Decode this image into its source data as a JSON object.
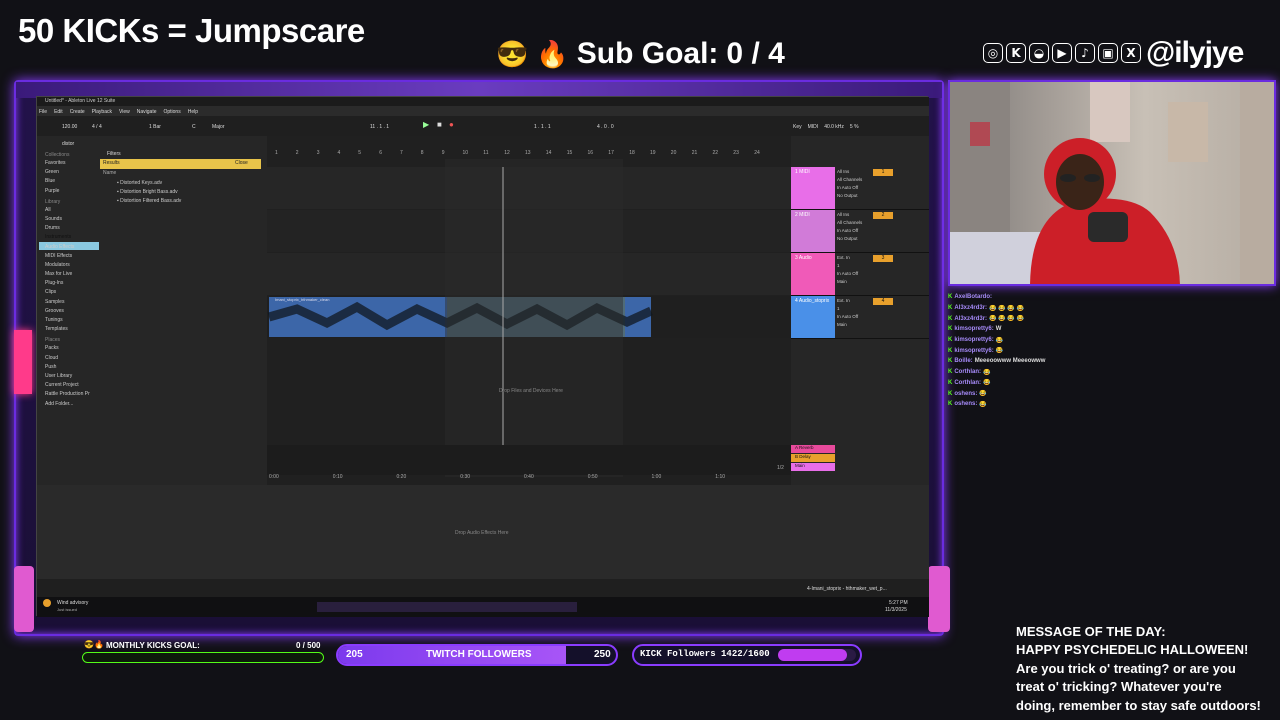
{
  "overlay": {
    "title": "50 KICKs = Jumpscare",
    "sub_goal_label": "Sub Goal:",
    "sub_goal_value": "0 / 4",
    "handle": "@ilyjye"
  },
  "social_icons": [
    "instagram-icon",
    "kick-icon",
    "snapchat-icon",
    "youtube-icon",
    "tiktok-icon",
    "twitch-icon",
    "x-icon"
  ],
  "ableton": {
    "window_title": "Untitled* - Ableton Live 12 Suite",
    "menu": [
      "File",
      "Edit",
      "Create",
      "Playback",
      "View",
      "Navigate",
      "Options",
      "Help"
    ],
    "transport": {
      "tempo": "120.00",
      "signature": "4 / 4",
      "bar": "1 Bar",
      "key": "C",
      "scale": "Major",
      "position": "11 . 1 . 1",
      "loop_start": "1 . 1 . 1",
      "loop_len": "4 . 0 . 0"
    },
    "browser": {
      "search": "distor",
      "filters": "Filters",
      "results": "Results",
      "close": "Close",
      "name_header": "Name",
      "collections_title": "Collections",
      "collections": [
        "Favorites",
        "Green",
        "Blue",
        "Purple"
      ],
      "library_title": "Library",
      "library": [
        "All",
        "Sounds",
        "Drums",
        "Instruments",
        "Audio Effects",
        "MIDI Effects",
        "Modulators",
        "Max for Live",
        "Plug-Ins",
        "Clips",
        "Samples",
        "Grooves",
        "Tunings",
        "Templates"
      ],
      "places_title": "Places",
      "places": [
        "Packs",
        "Cloud",
        "Push",
        "User Library",
        "Current Project",
        "Rattle Production Pr",
        "Add Folder..."
      ],
      "files": [
        "Distorted Keys.adv",
        "Distortion Bright Bass.adv",
        "Distortion Filtered Bass.adv"
      ]
    },
    "ruler": [
      "1",
      "2",
      "3",
      "4",
      "5",
      "6",
      "7",
      "8",
      "9",
      "10",
      "11",
      "12",
      "13",
      "14",
      "15",
      "16",
      "17",
      "18",
      "19",
      "20",
      "21",
      "22",
      "23",
      "24"
    ],
    "timecodes": [
      "0:00",
      "0:10",
      "0:20",
      "0:30",
      "0:40",
      "0:50",
      "1:00",
      "1:10"
    ],
    "tracks": [
      {
        "name": "1 MIDI",
        "color": "#e86ee8",
        "num": "1",
        "routing": [
          "All Ins",
          "All Channels",
          "In Auto Off",
          "No Output"
        ]
      },
      {
        "name": "2 MIDI",
        "color": "#d17bd8",
        "num": "2",
        "routing": [
          "All Ins",
          "All Channels",
          "In Auto Off",
          "No Output"
        ]
      },
      {
        "name": "3 Audio",
        "color": "#f05ab8",
        "num": "3",
        "routing": [
          "Ext. In",
          "1",
          "In Auto Off",
          "Main"
        ]
      },
      {
        "name": "4 Audio_stoprix",
        "color": "#4a90e8",
        "num": "4",
        "routing": [
          "Ext. In",
          "1",
          "In Auto Off",
          "Main"
        ]
      }
    ],
    "return_tracks": [
      {
        "name": "A Reverb",
        "color": "#e84a9c"
      },
      {
        "name": "B Delay",
        "color": "#e8a02c"
      },
      {
        "name": "Main",
        "color": "#e86ee8"
      }
    ],
    "clip_name": "Imani_stoprix_hthmaker_clean",
    "drop_files": "Drop Files and Devices Here",
    "drop_audio": "Drop Audio Effects Here",
    "zoom": "1/2",
    "status_clip": "4-Imani_stoprix - hthmaker_wet_p...",
    "top_right": [
      "Key",
      "MIDI",
      "40.0 kHz",
      "5 %"
    ]
  },
  "taskbar": {
    "weather_title": "Wind advisory",
    "weather_sub": "Just issued",
    "time": "5:27 PM",
    "date": "11/3/2025"
  },
  "chat": [
    {
      "name": "AxelBotardo",
      "msg": ""
    },
    {
      "name": "Al3xz4rd3r",
      "msg": "😂 😂 😂 😂"
    },
    {
      "name": "Al3xz4rd3r",
      "msg": "😂 😂 😂 😂"
    },
    {
      "name": "kimsopretty6",
      "msg": "W"
    },
    {
      "name": "kimsopretty6",
      "msg": "😂"
    },
    {
      "name": "kimsopretty6",
      "msg": "😂"
    },
    {
      "name": "Boille",
      "msg": "Meeeoowww Meeeowww"
    },
    {
      "name": "Corthlan",
      "msg": "😂"
    },
    {
      "name": "Corthlan",
      "msg": "😂"
    },
    {
      "name": "oshens",
      "msg": "😂"
    },
    {
      "name": "oshens",
      "msg": "😂"
    }
  ],
  "goals": {
    "monthly_label": "MONTHLY KICKS GOAL:",
    "monthly_value": "0 / 500",
    "monthly_progress": 0,
    "twitch_left": "205",
    "twitch_label": "TWITCH FOLLOWERS",
    "twitch_right": "250",
    "twitch_progress": 0.82,
    "kick_label": "KICK Followers 1422/1600",
    "kick_progress": 0.89
  },
  "motd": {
    "title": "MESSAGE OF THE DAY:",
    "lines": [
      "HAPPY PSYCHEDELIC HALLOWEEN!",
      "Are you trick o' treating? or are you",
      "treat o' tricking? Whatever you're",
      "doing, remember to stay safe outdoors!"
    ]
  },
  "colors": {
    "accent": "#8a3cff",
    "kick_green": "#53fc18",
    "ableton_bg": "#242424",
    "clip_blue": "#4a90e8"
  }
}
